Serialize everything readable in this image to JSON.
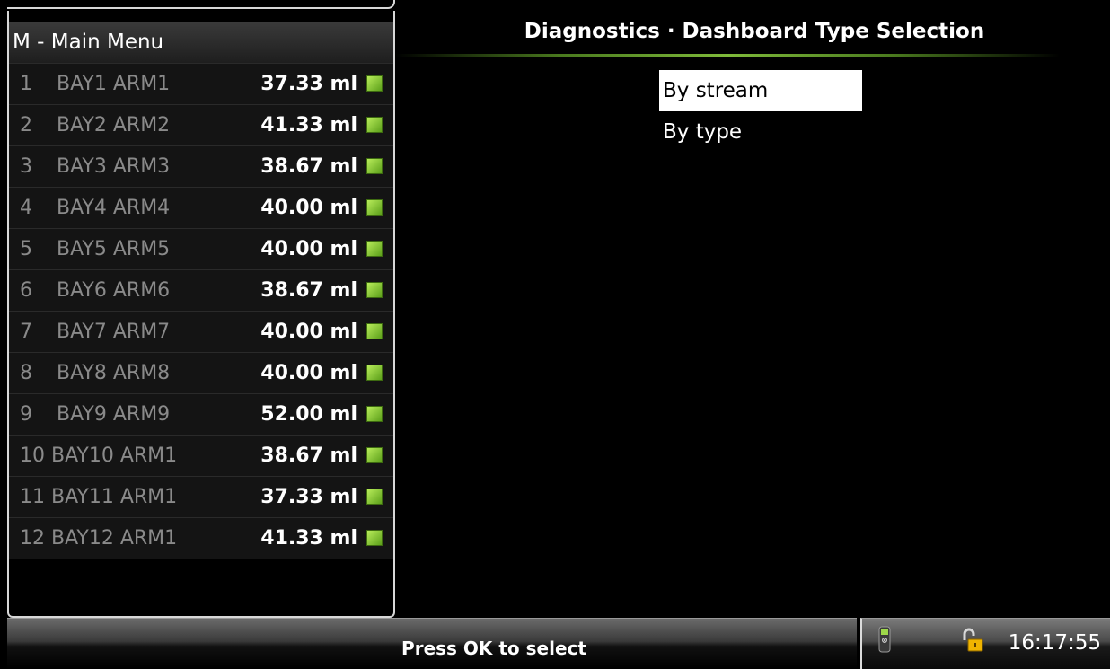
{
  "header": {
    "menu_label": "M - Main Menu",
    "title": "Diagnostics · Dashboard Type Selection"
  },
  "bays": [
    {
      "index": "1",
      "name": "BAY1 ARM1",
      "value": "37.33 ml",
      "status_color": "#8cd43a"
    },
    {
      "index": "2",
      "name": "BAY2 ARM2",
      "value": "41.33 ml",
      "status_color": "#8cd43a"
    },
    {
      "index": "3",
      "name": "BAY3 ARM3",
      "value": "38.67 ml",
      "status_color": "#8cd43a"
    },
    {
      "index": "4",
      "name": "BAY4 ARM4",
      "value": "40.00 ml",
      "status_color": "#8cd43a"
    },
    {
      "index": "5",
      "name": "BAY5 ARM5",
      "value": "40.00 ml",
      "status_color": "#8cd43a"
    },
    {
      "index": "6",
      "name": "BAY6 ARM6",
      "value": "38.67 ml",
      "status_color": "#8cd43a"
    },
    {
      "index": "7",
      "name": "BAY7 ARM7",
      "value": "40.00 ml",
      "status_color": "#8cd43a"
    },
    {
      "index": "8",
      "name": "BAY8 ARM8",
      "value": "40.00 ml",
      "status_color": "#8cd43a"
    },
    {
      "index": "9",
      "name": "BAY9 ARM9",
      "value": "52.00 ml",
      "status_color": "#8cd43a"
    },
    {
      "index": "",
      "name": "10 BAY10 ARM1",
      "value": "38.67 ml",
      "status_color": "#8cd43a"
    },
    {
      "index": "",
      "name": "11 BAY11 ARM1",
      "value": "37.33 ml",
      "status_color": "#8cd43a"
    },
    {
      "index": "",
      "name": "12 BAY12 ARM1",
      "value": "41.33 ml",
      "status_color": "#8cd43a"
    }
  ],
  "options": [
    {
      "label": "By stream",
      "selected": true
    },
    {
      "label": "By type",
      "selected": false
    }
  ],
  "status_bar": {
    "message": "Press OK to select",
    "device_icon": "handheld-device-icon",
    "lock_icon": "unlocked-padlock-icon",
    "time": "16:17:55"
  },
  "colors": {
    "accent_green": "#7fba3a",
    "selection_bg": "#ffffff"
  }
}
